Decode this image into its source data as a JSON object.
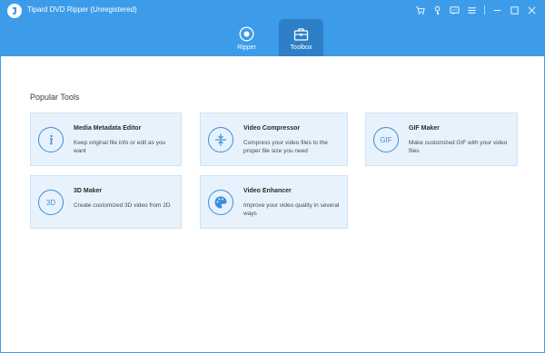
{
  "app": {
    "title": "Tipard DVD Ripper (Unregistered)",
    "accent": "#3d9cea",
    "active_tab_bg": "#2e7fc7"
  },
  "titlebar": {
    "icons": [
      "cart-icon",
      "key-icon",
      "feedback-icon",
      "menu-icon",
      "minimize-icon",
      "maximize-icon",
      "close-icon"
    ]
  },
  "tabs": [
    {
      "label": "Ripper",
      "icon": "ripper-disc-icon",
      "active": false
    },
    {
      "label": "Toolbox",
      "icon": "toolbox-icon",
      "active": true
    }
  ],
  "main": {
    "section_title": "Popular Tools",
    "tools": [
      {
        "name": "Media Metadata Editor",
        "description": "Keep original file info or edit as you want",
        "icon": "info-icon"
      },
      {
        "name": "Video Compressor",
        "description": "Compress your video files to the proper file size you need",
        "icon": "compress-icon"
      },
      {
        "name": "GIF Maker",
        "description": "Make customized GIF with your video files",
        "icon": "gif-icon",
        "icon_text": "GIF"
      },
      {
        "name": "3D Maker",
        "description": "Create customized 3D video from 2D",
        "icon": "3d-icon",
        "icon_text": "3D"
      },
      {
        "name": "Video Enhancer",
        "description": "Improve your video quality in several ways",
        "icon": "palette-icon"
      }
    ]
  }
}
